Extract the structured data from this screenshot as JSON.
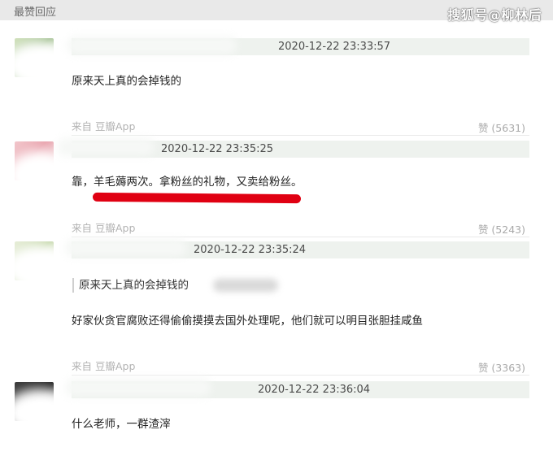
{
  "section": {
    "title": "最赞回应"
  },
  "watermark": {
    "text": "搜狐号@柳林后"
  },
  "comments": [
    {
      "timestamp": "2020-12-22 23:33:57",
      "content": "原来天上真的会掉钱的",
      "source": "来自 豆瓣App",
      "likes": "赞 (5631)"
    },
    {
      "timestamp": "2020-12-22 23:35:25",
      "content": "靠，羊毛薅两次。拿粉丝的礼物，又卖给粉丝。",
      "source": "来自 豆瓣App",
      "likes": "赞 (5243)"
    },
    {
      "timestamp": "2020-12-22 23:35:24",
      "quote": "原来天上真的会掉钱的",
      "content": "好家伙贪官腐败还得偷偷摸摸去国外处理呢，他们就可以明目张胆挂咸鱼",
      "source": "来自 豆瓣App",
      "likes": "赞 (3363)"
    },
    {
      "timestamp": "2020-12-22 23:36:04",
      "content": "什么老师，一群渣滓"
    }
  ],
  "colors": {
    "header_bg": "#e9e9e9",
    "meta_bar_bg": "#eef2ee",
    "highlight_red": "#e00012",
    "muted_text": "#b3b3b3"
  }
}
